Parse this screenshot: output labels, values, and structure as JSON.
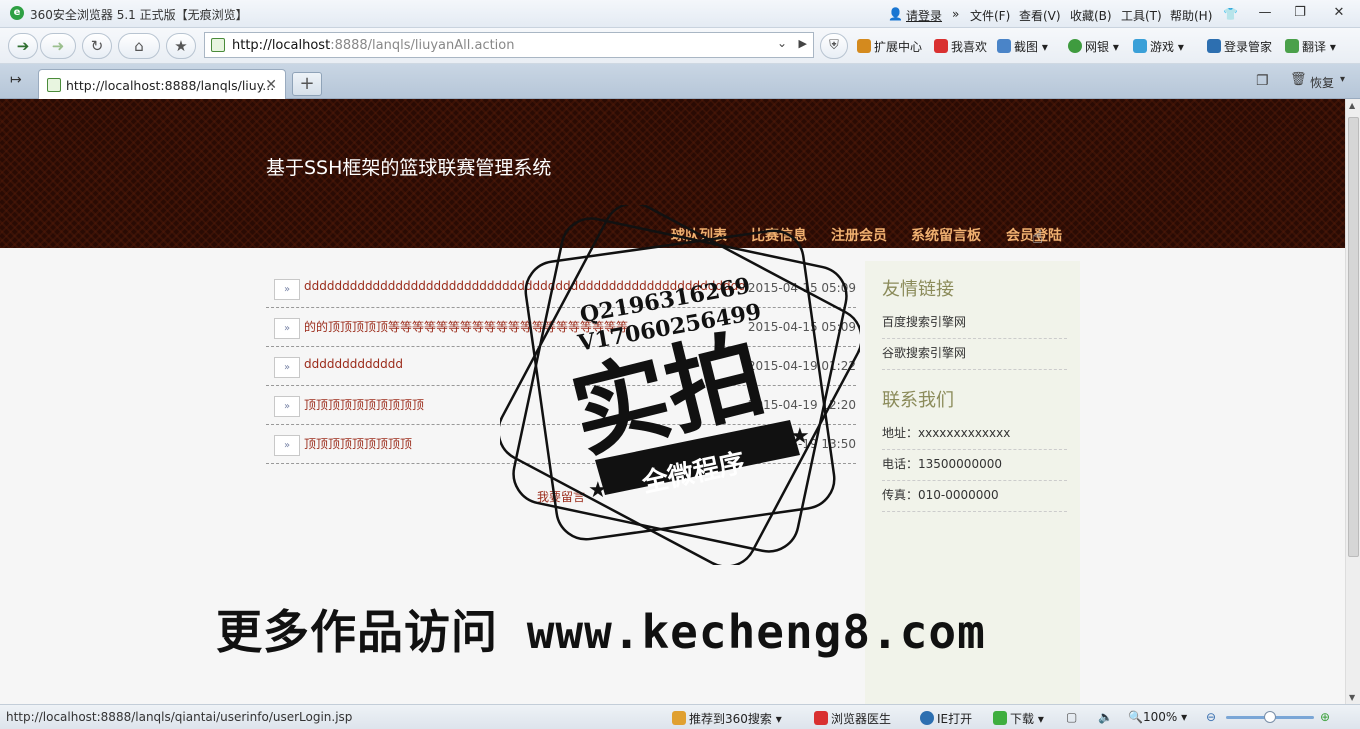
{
  "window": {
    "title": "360安全浏览器 5.1 正式版【无痕浏览】",
    "login": "请登录",
    "menus": [
      "文件(F)",
      "查看(V)",
      "收藏(B)",
      "工具(T)",
      "帮助(H)"
    ]
  },
  "toolbar": {
    "url_host": "http://localhost",
    "url_rest": ":8888/lanqls/liuyanAll.action",
    "items": [
      "扩展中心",
      "我喜欢",
      "截图",
      "网银",
      "游戏",
      "登录管家",
      "翻译"
    ]
  },
  "tabs": [
    {
      "title": "http://localhost:8888/lanqls/liuy..."
    }
  ],
  "tabbar_right": "恢复",
  "site": {
    "title": "基于SSH框架的篮球联赛管理系统",
    "nav": [
      "球队列表",
      "比赛信息",
      "注册会员",
      "系统留言板",
      "会员登陆"
    ]
  },
  "messages": [
    {
      "text": "ddddddddddddddddddddddddddddddddddddddddddddddddddddddddddd",
      "time": "2015-04-15 05:09"
    },
    {
      "text": "的的顶顶顶顶顶等等等等等等等等等等等等等等等等等等等等",
      "time": "2015-04-15 05:09"
    },
    {
      "text": "ddddddddddddd",
      "time": "2015-04-19 01:22"
    },
    {
      "text": "顶顶顶顶顶顶顶顶顶顶",
      "time": "2015-04-19 12:20"
    },
    {
      "text": "顶顶顶顶顶顶顶顶顶",
      "time": "2015-04-19 13:50"
    }
  ],
  "leave_message": "我要留言",
  "sidebar": {
    "links_title": "友情链接",
    "links": [
      "百度搜索引擎网",
      "谷歌搜索引擎网"
    ],
    "contact_title": "联系我们",
    "contact": [
      "地址：xxxxxxxxxxxxx",
      "电话：13500000000",
      "传真：010-0000000"
    ]
  },
  "statusbar": {
    "url": "http://localhost:8888/lanqls/qiantai/userinfo/userLogin.jsp",
    "items": [
      "推荐到360搜索",
      "浏览器医生",
      "IE打开",
      "下载"
    ],
    "zoom": "100%"
  },
  "watermark": {
    "qq": "Q2196316269",
    "vx": "V17060256499",
    "stamp_main": "实拍",
    "stamp_sub": "全微程序",
    "footer_cn": "更多作品访问",
    "footer_url": "www.kecheng8.com"
  }
}
